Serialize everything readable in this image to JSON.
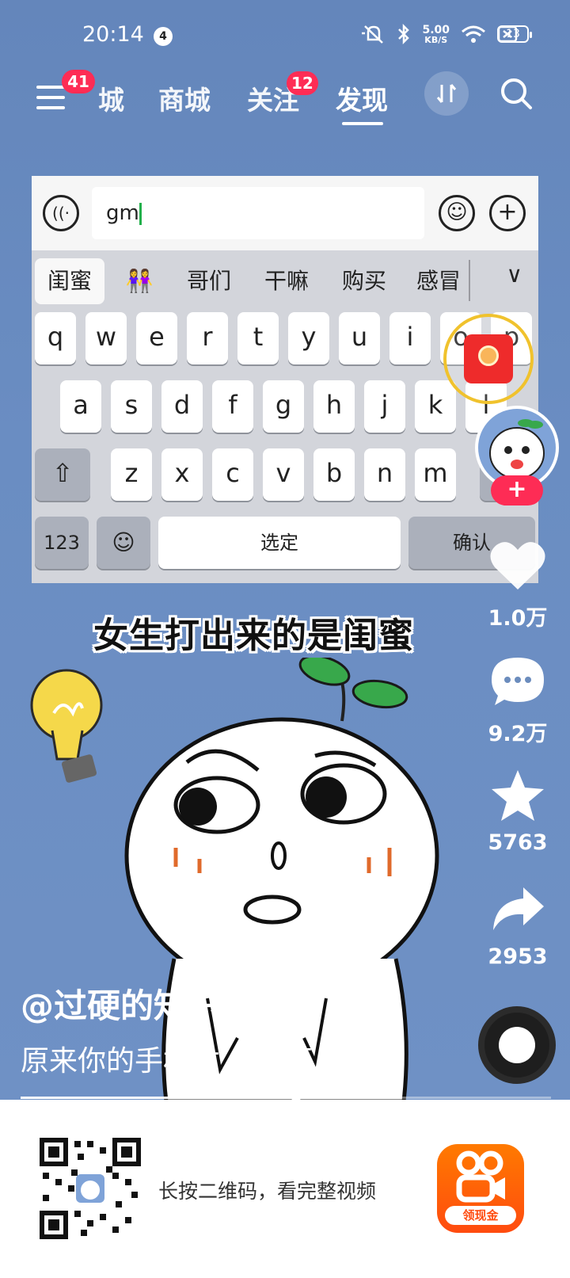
{
  "status_bar": {
    "time": "20:14",
    "notification_count": "4",
    "net_speed_value": "5.00",
    "net_speed_unit": "KB/S",
    "battery": "13",
    "icons": [
      "mute-icon",
      "bluetooth-icon",
      "wifi-icon",
      "sim-off-icon",
      "battery-icon"
    ]
  },
  "top_nav": {
    "menu_badge": "41",
    "tabs": [
      {
        "label": "城",
        "active": false
      },
      {
        "label": "商城",
        "active": false
      },
      {
        "label": "关注",
        "active": false,
        "badge": "12"
      },
      {
        "label": "发现",
        "active": true
      }
    ]
  },
  "keyboard": {
    "input_text": "gm",
    "candidates": [
      "闺蜜",
      "👭",
      "哥们",
      "干嘛",
      "购买",
      "感冒"
    ],
    "row1": [
      "q",
      "w",
      "e",
      "r",
      "t",
      "y",
      "u",
      "i",
      "o",
      "p"
    ],
    "row2": [
      "a",
      "s",
      "d",
      "f",
      "g",
      "h",
      "j",
      "k",
      "l"
    ],
    "row3": [
      "z",
      "x",
      "c",
      "v",
      "b",
      "n",
      "m"
    ],
    "key_123": "123",
    "key_space": "选定",
    "key_confirm": "确认"
  },
  "video": {
    "caption": "女生打出来的是闺蜜",
    "author": "@过硬的知识",
    "description": "原来你的手机才... 展开",
    "progress": 0.52
  },
  "actions": {
    "likes": "1.0万",
    "comments": "9.2万",
    "favorites": "5763",
    "shares": "2953"
  },
  "banner": {
    "text": "长按二维码，看完整视频",
    "app_label": "领现金",
    "accent": "#ff4b0f"
  }
}
